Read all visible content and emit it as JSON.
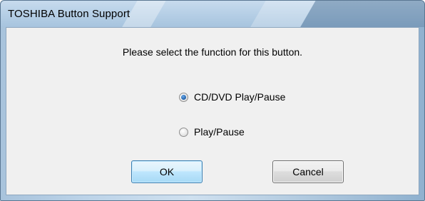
{
  "window": {
    "title": "TOSHIBA Button Support"
  },
  "dialog": {
    "prompt": "Please select the function for this button.",
    "options": [
      {
        "label": "CD/DVD Play/Pause",
        "selected": true
      },
      {
        "label": "Play/Pause",
        "selected": false
      }
    ],
    "ok_label": "OK",
    "cancel_label": "Cancel"
  },
  "colors": {
    "titlebar": "#b6cfe6",
    "client_background": "#f0f0f0",
    "ok_border": "#3c7fb1",
    "radio_selected": "#1f5fa8"
  }
}
